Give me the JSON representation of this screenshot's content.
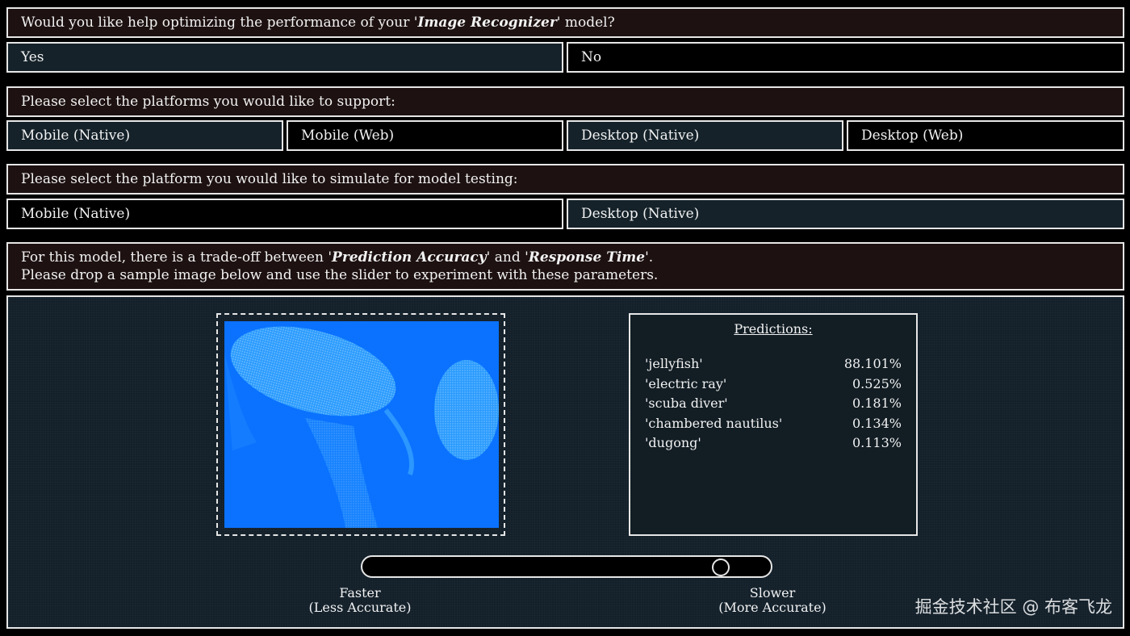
{
  "q1": {
    "prefix": "Would you like help optimizing the performance of your '",
    "model": "Image Recognizer",
    "suffix": "' model?"
  },
  "q1_options": [
    "Yes",
    "No"
  ],
  "platforms_prompt": "Please select the platforms you would like to support:",
  "platforms": [
    "Mobile (Native)",
    "Mobile (Web)",
    "Desktop (Native)",
    "Desktop (Web)"
  ],
  "simulate_prompt": "Please select the platform you would like to simulate for model testing:",
  "simulate_options": [
    "Mobile (Native)",
    "Desktop (Native)"
  ],
  "tradeoff": {
    "line1_prefix": "For this model, there is a trade-off between '",
    "accuracy": "Prediction Accuracy",
    "line1_mid": "' and '",
    "response": "Response Time",
    "line1_suffix": "'.",
    "line2": "Please drop a sample image below and use the slider to experiment with these parameters."
  },
  "predictions": {
    "title": "Predictions:",
    "rows": [
      {
        "label": "'jellyfish'",
        "value": "88.101%"
      },
      {
        "label": "'electric ray'",
        "value": "0.525%"
      },
      {
        "label": "'scuba diver'",
        "value": "0.181%"
      },
      {
        "label": "'chambered nautilus'",
        "value": "0.134%"
      },
      {
        "label": "'dugong'",
        "value": "0.113%"
      }
    ]
  },
  "slider": {
    "value_fraction": 0.9,
    "left_label_1": "Faster",
    "left_label_2": "(Less Accurate)",
    "right_label_1": "Slower",
    "right_label_2": "(More Accurate)"
  },
  "watermark": "掘金技术社区 @ 布客飞龙",
  "colors": {
    "selected_bg": "#15222a",
    "question_bg": "#1d1111",
    "image_blue": "#0a72ff"
  }
}
